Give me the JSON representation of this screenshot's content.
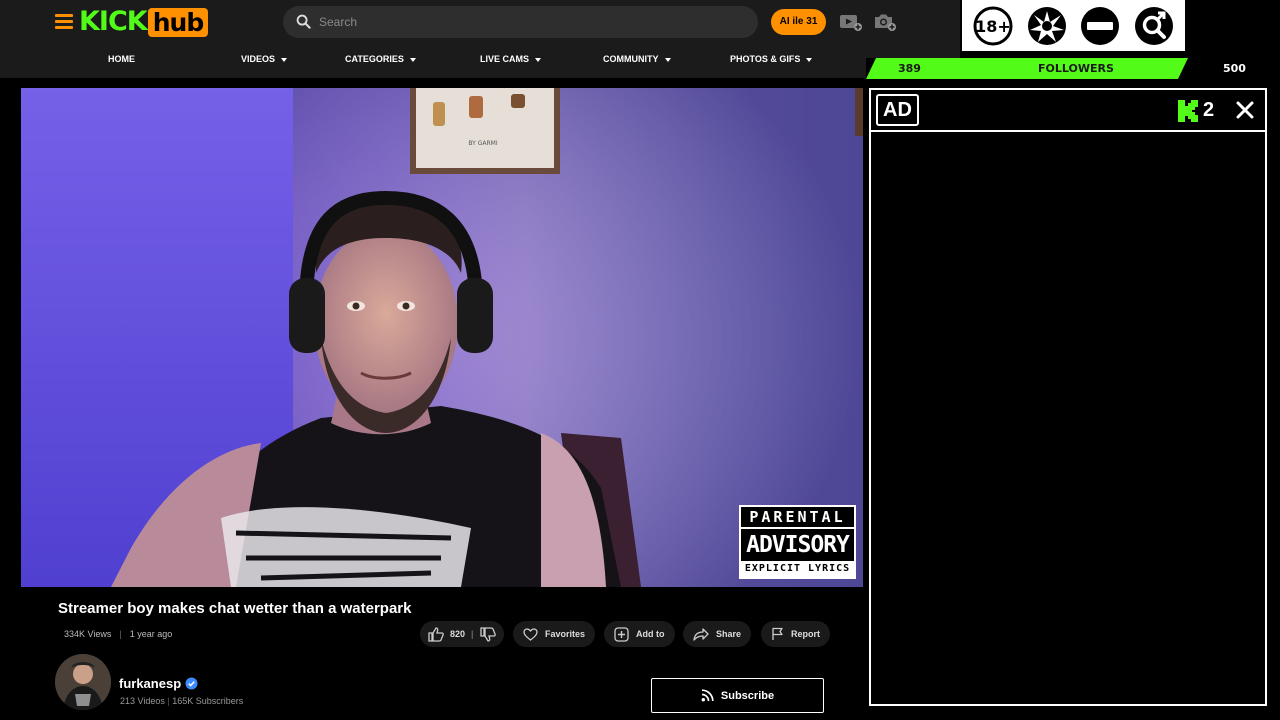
{
  "header": {
    "logo_kick": "KICK",
    "logo_hub": "hub",
    "search_placeholder": "Search",
    "ai_button": "AI ile 31",
    "nav": [
      {
        "label": "HOME",
        "caret": false
      },
      {
        "label": "VIDEOS",
        "caret": true
      },
      {
        "label": "CATEGORIES",
        "caret": true
      },
      {
        "label": "LIVE CAMS",
        "caret": true
      },
      {
        "label": "COMMUNITY",
        "caret": true
      },
      {
        "label": "PHOTOS & GIFS",
        "caret": true
      }
    ]
  },
  "overlay": {
    "badges": [
      "age-18-plus-icon",
      "splat-icon",
      "no-entry-icon",
      "gender-search-icon"
    ],
    "age_label": "18+",
    "followers": {
      "current": "389",
      "label": "FOLLOWERS",
      "goal": "500",
      "progress": 0.778
    },
    "ad": {
      "tag": "AD",
      "count": "2",
      "brand_letter": "K"
    }
  },
  "video": {
    "poster_caption": "BY GARMI",
    "advisory": {
      "line1": "PARENTAL",
      "line2": "ADVISORY",
      "line3": "EXPLICIT LYRICS"
    }
  },
  "info": {
    "title": "Streamer boy makes chat wetter than a waterpark",
    "views": "334K Views",
    "age": "1 year ago",
    "likes": "820",
    "favorites": "Favorites",
    "add_to": "Add to",
    "share": "Share",
    "report": "Report"
  },
  "channel": {
    "name": "furkanesp",
    "videos": "213 Videos",
    "subscribers": "165K Subscribers",
    "subscribe": "Subscribe"
  },
  "colors": {
    "brand_orange": "#ff9000",
    "kick_green": "#53fc18",
    "verified_blue": "#3d8bfd"
  }
}
